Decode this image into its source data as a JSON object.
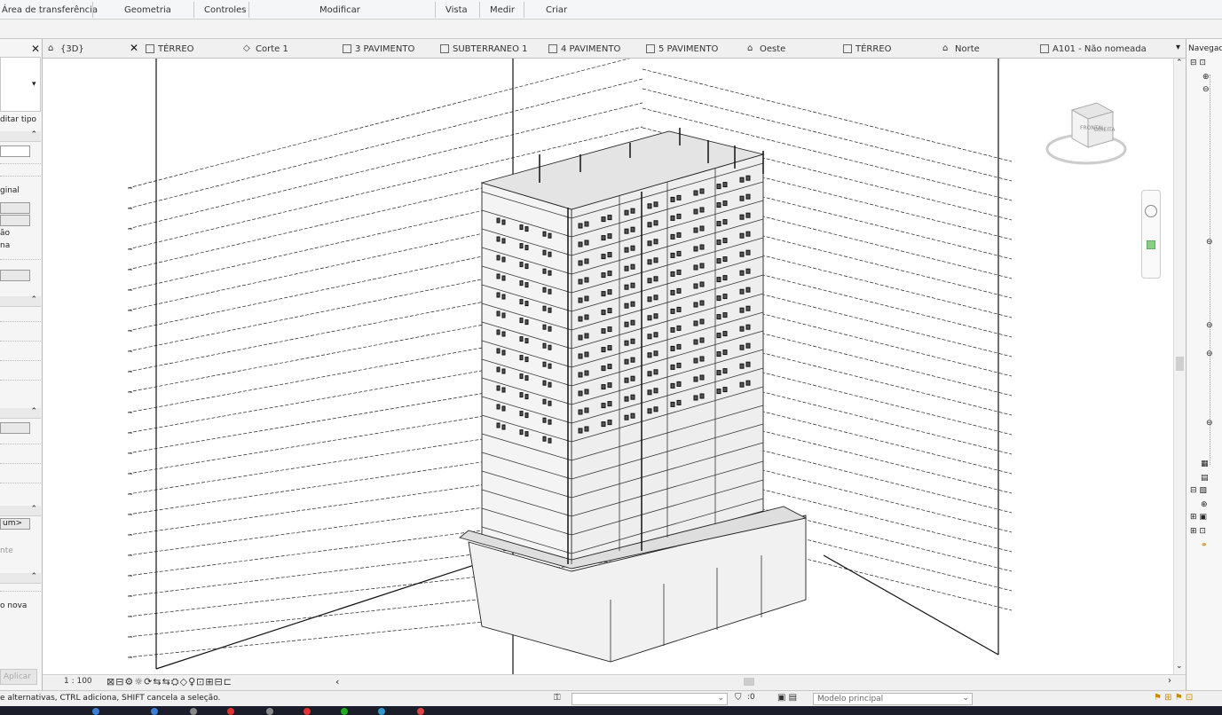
{
  "ribbon": {
    "groups": [
      "Área de transferência",
      "Geometria",
      "Controles",
      "Modificar",
      "Vista",
      "Medir",
      "Criar"
    ]
  },
  "properties": {
    "close": "✕",
    "edit_type": "ditar tipo",
    "lines": [
      "ginal",
      "ão",
      "na"
    ],
    "field_value": "um>",
    "field_placeholder": "nte",
    "last_text": "o nova",
    "apply": "Aplicar"
  },
  "tabs": [
    {
      "label": "{3D}",
      "active": true
    },
    {
      "label": "TÉRREO"
    },
    {
      "label": "Corte 1"
    },
    {
      "label": "3 PAVIMENTO"
    },
    {
      "label": "SUBTERRANEO 1"
    },
    {
      "label": "4 PAVIMENTO"
    },
    {
      "label": "5 PAVIMENTO"
    },
    {
      "label": "Oeste"
    },
    {
      "label": "TÉRREO"
    },
    {
      "label": "Norte"
    },
    {
      "label": "A101 - Não nomeada"
    }
  ],
  "tab_close": "✕",
  "tab_menu": "▾",
  "viewcube": {
    "front": "FRONTAL",
    "right": "DIREITA"
  },
  "viewbar": {
    "scale": "1 : 100",
    "icons": "⊠⊟⚙☼⟳⇆⇆⛭◇♀⊡⊞⊟⊏",
    "chev": "‹",
    "right": "›"
  },
  "navigator": {
    "title": "Navegad"
  },
  "status": {
    "message": "e alternativas, CTRL adiciona, SHIFT cancela a seleção.",
    "counter": ":0",
    "model": "Modelo principal"
  },
  "colors": {
    "accent": "#2b7cd3",
    "taskbar": "#1b1e2a"
  }
}
